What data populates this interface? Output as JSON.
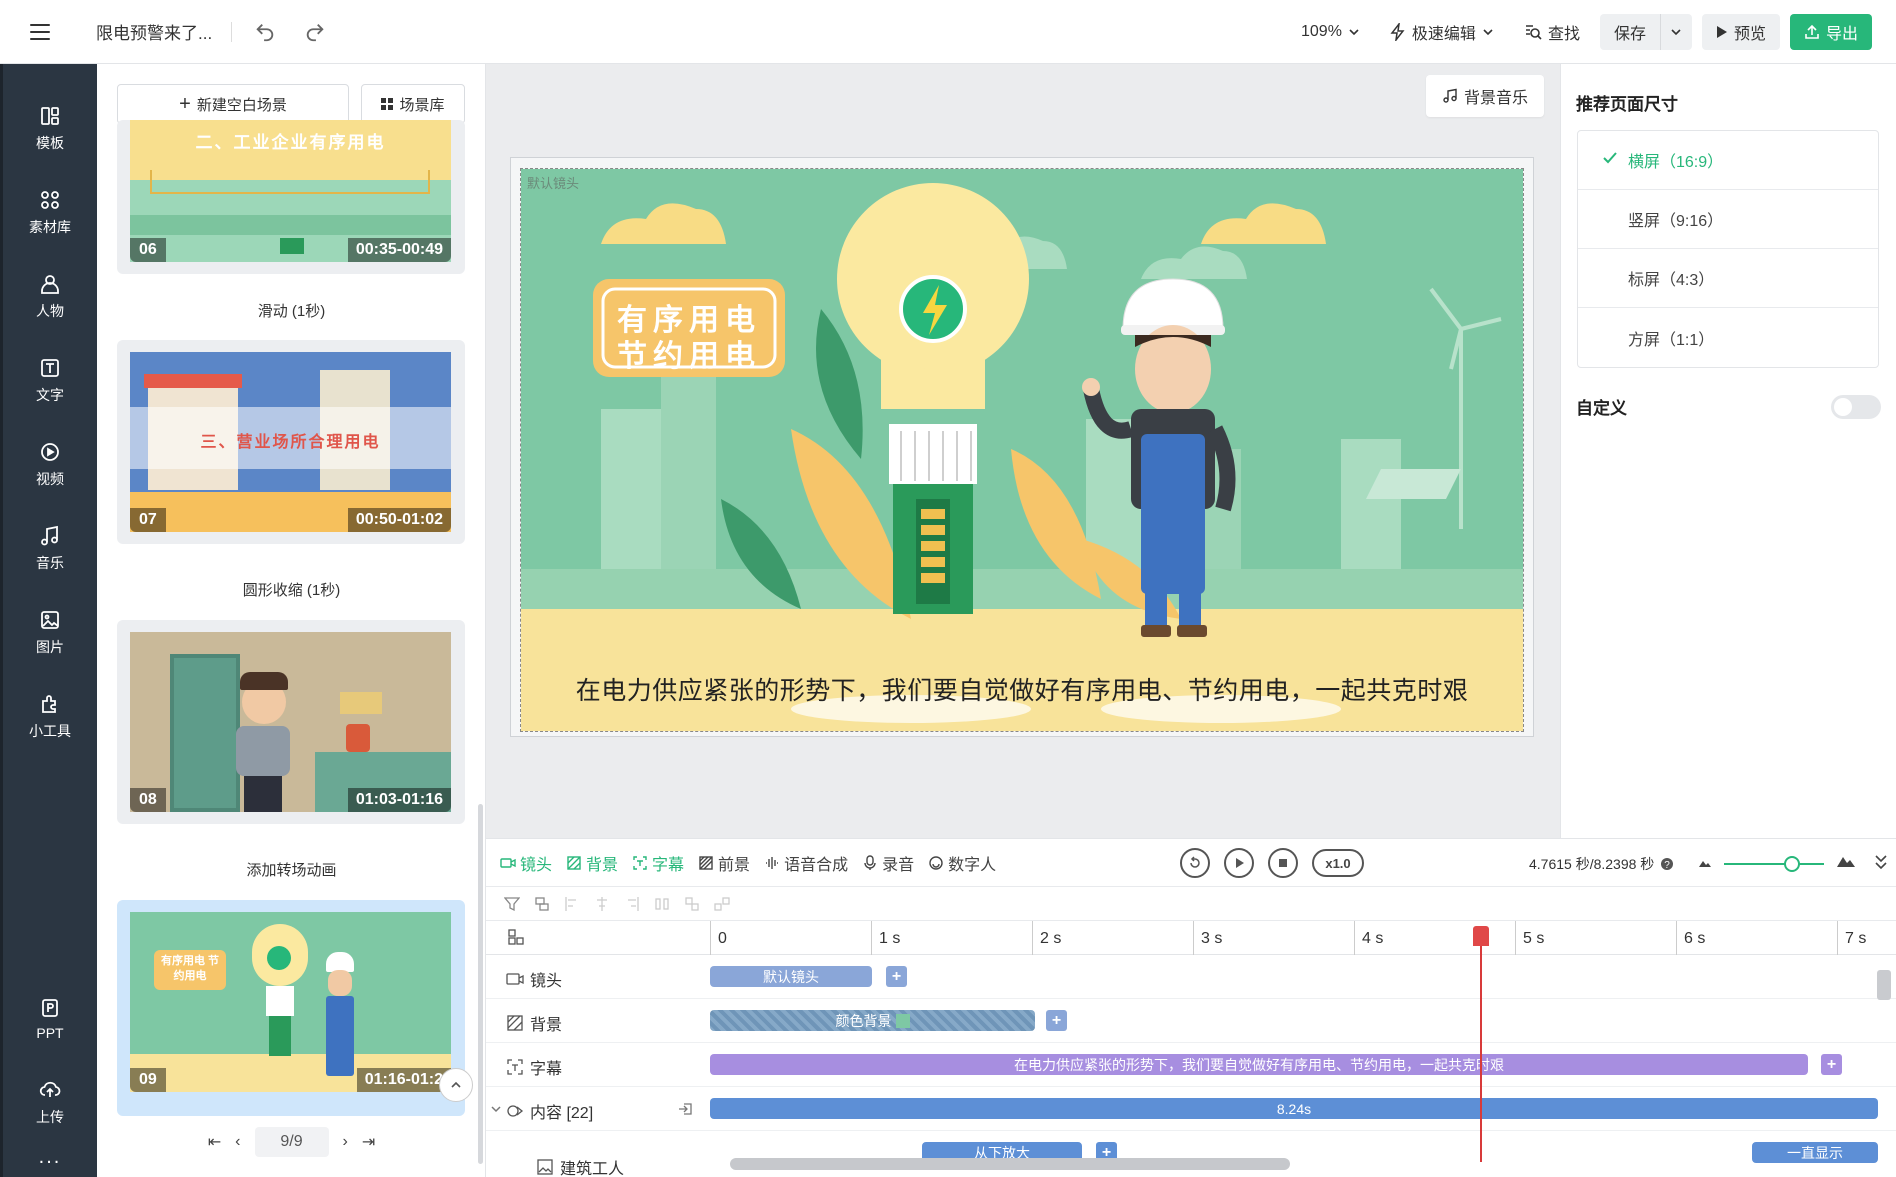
{
  "topbar": {
    "doc_title": "限电预警来了...",
    "zoom": "109%",
    "mode": "极速编辑",
    "find": "查找",
    "save": "保存",
    "preview": "预览",
    "export": "导出"
  },
  "nav": {
    "items": [
      {
        "label": "模板",
        "icon": "template-icon"
      },
      {
        "label": "素材库",
        "icon": "grid-icon"
      },
      {
        "label": "人物",
        "icon": "person-icon"
      },
      {
        "label": "文字",
        "icon": "text-icon"
      },
      {
        "label": "视频",
        "icon": "video-icon"
      },
      {
        "label": "音乐",
        "icon": "music-icon"
      },
      {
        "label": "图片",
        "icon": "image-icon"
      },
      {
        "label": "小工具",
        "icon": "puzzle-icon"
      }
    ],
    "ppt": "PPT",
    "upload": "上传",
    "more": "..."
  },
  "scenes": {
    "new_blank": "新建空白场景",
    "library": "场景库",
    "cards": [
      {
        "index": "06",
        "time": "00:35-00:49",
        "banner": "二、工业企业有序用电",
        "transition": "滑动 (1秒)"
      },
      {
        "index": "07",
        "time": "00:50-01:02",
        "banner": "三、营业场所合理用电",
        "transition": "圆形收缩 (1秒)"
      },
      {
        "index": "08",
        "time": "01:03-01:16",
        "transition": "添加转场动画"
      },
      {
        "index": "09",
        "time": "01:16-01:2",
        "banner": "有序用电 节约用电"
      }
    ],
    "pager": "9/9"
  },
  "canvas": {
    "bgm": "背景音乐",
    "stage_label": "默认镜头",
    "headline_line1": "有序用电",
    "headline_line2": "节约用电",
    "subtitle": "在电力供应紧张的形势下，我们要自觉做好有序用电、节约用电，一起共克时艰",
    "colors": {
      "bg": "#7ec8a4",
      "accent": "#f6c56a",
      "bulb": "#fbe9a0",
      "ground": "#f8e39a"
    }
  },
  "right_panel": {
    "title": "推荐页面尺寸",
    "sizes": [
      {
        "label": "横屏（16:9）",
        "selected": true
      },
      {
        "label": "竖屏（9:16）",
        "selected": false
      },
      {
        "label": "标屏（4:3）",
        "selected": false
      },
      {
        "label": "方屏（1:1）",
        "selected": false
      }
    ],
    "custom": "自定义"
  },
  "timeline": {
    "tabs": [
      "镜头",
      "背景",
      "字幕",
      "前景",
      "语音合成",
      "录音",
      "数字人"
    ],
    "speed": "x1.0",
    "time": "4.7615 秒/8.2398 秒",
    "ticks": [
      "0",
      "1 s",
      "2 s",
      "3 s",
      "4 s",
      "5 s",
      "6 s",
      "7 s"
    ],
    "tracks": [
      {
        "name": "镜头",
        "clip": "默认镜头"
      },
      {
        "name": "背景",
        "clip": "颜色背景"
      },
      {
        "name": "字幕",
        "clip": "在电力供应紧张的形势下，我们要自觉做好有序用电、节约用电，一起共克时艰"
      },
      {
        "name": "内容 [22]",
        "clip": "8.24s"
      },
      {
        "name": "建筑工人",
        "clip": "从下放大",
        "clip2": "一直显示"
      }
    ]
  }
}
